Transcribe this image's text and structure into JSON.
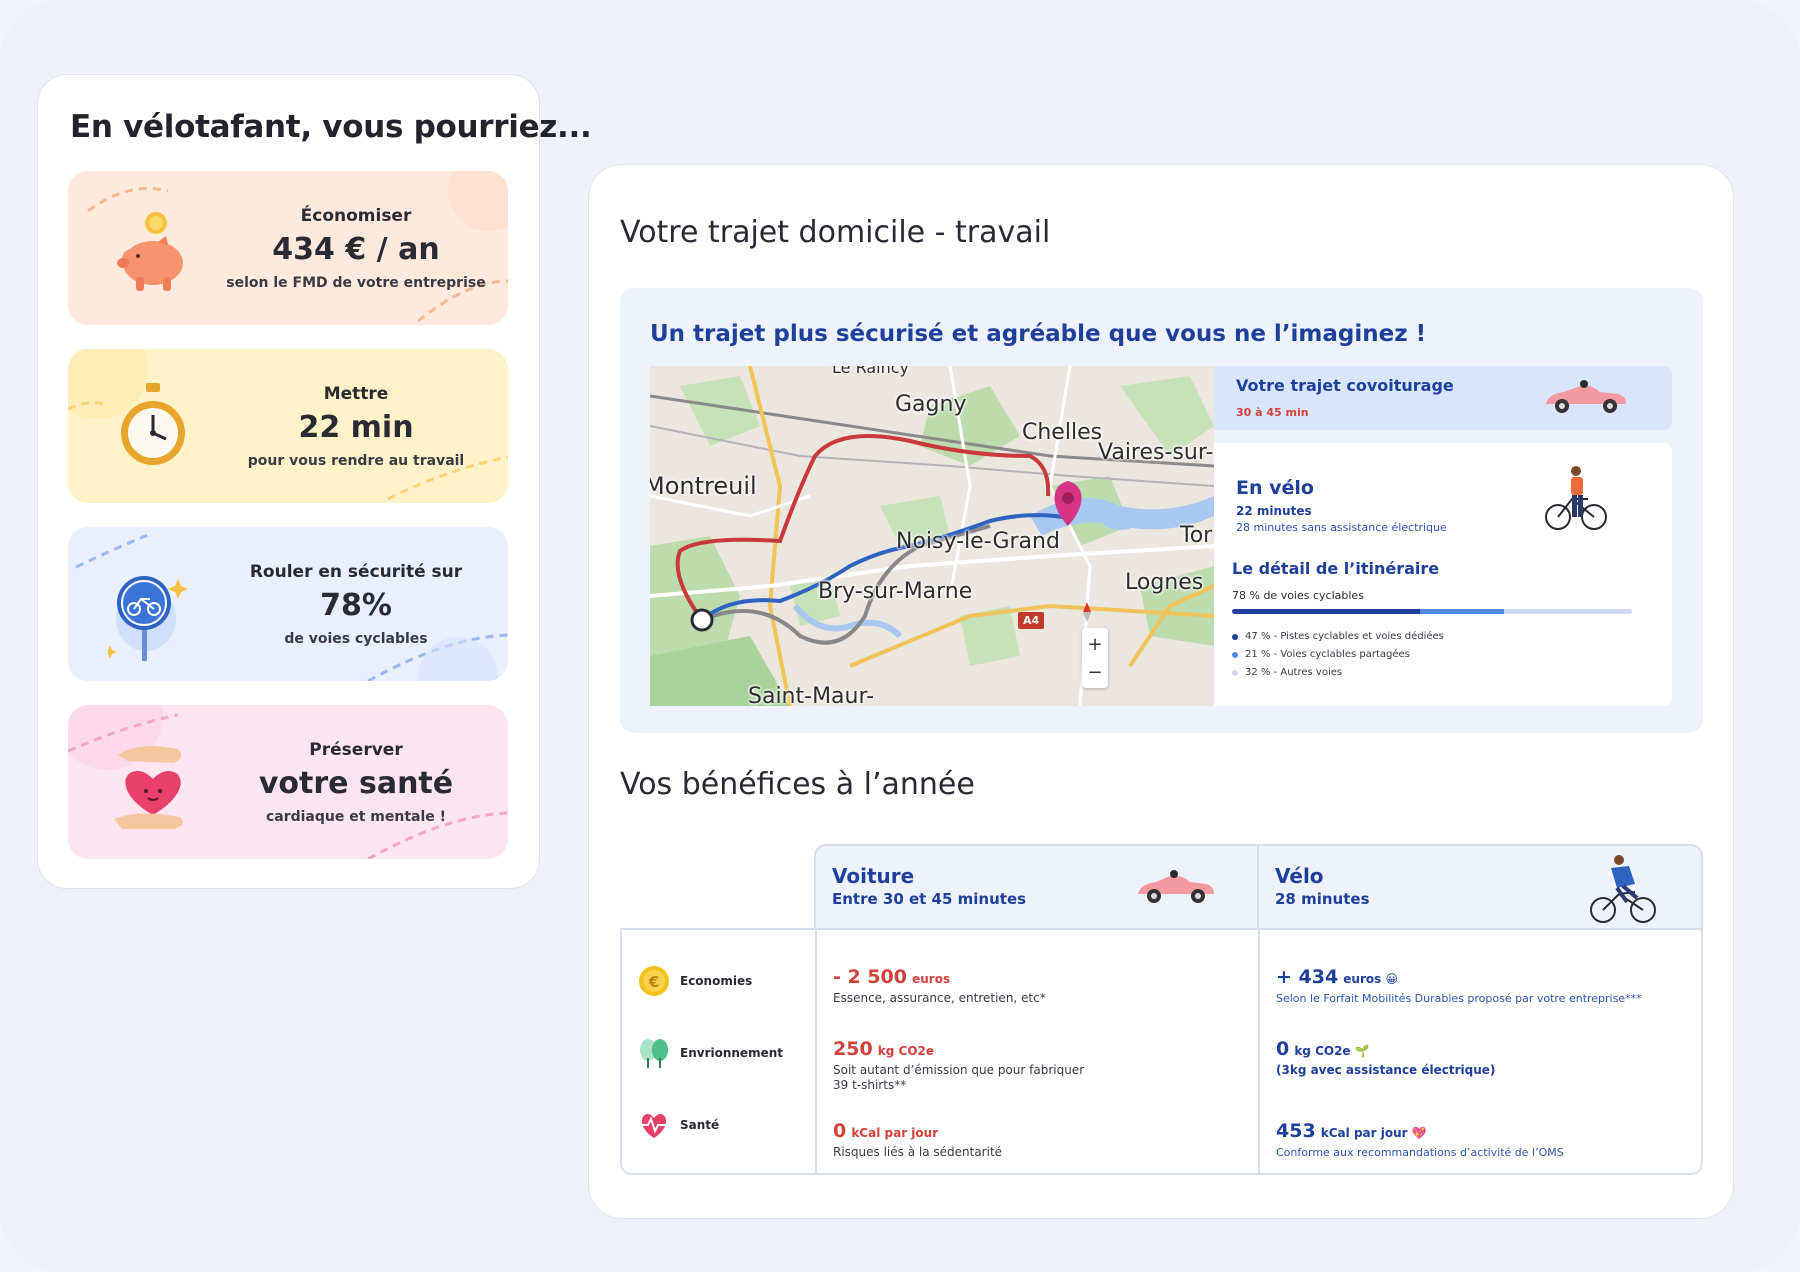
{
  "left": {
    "title": "En vélotafant, vous pourriez...",
    "cards": [
      {
        "l1": "Économiser",
        "l2": "434 € / an",
        "l3": "selon le FMD de votre entreprise",
        "icon": "piggy-bank-icon"
      },
      {
        "l1": "Mettre",
        "l2": "22 min",
        "l3": "pour vous rendre au travail",
        "icon": "stopwatch-icon"
      },
      {
        "l1": "Rouler en sécurité sur",
        "l2": "78%",
        "l3": "de voies cyclables",
        "icon": "bike-lane-sign-icon"
      },
      {
        "l1": "Préserver",
        "l2": "votre santé",
        "l3": "cardiaque et mentale !",
        "icon": "heart-in-hands-icon"
      }
    ]
  },
  "right": {
    "title": "Votre trajet domicile - travail",
    "trip_subtitle": "Un trajet plus sécurisé et agréable que vous ne l’imaginez !",
    "map": {
      "labels": [
        "Le Raincy",
        "Gagny",
        "Chelles",
        "Vaires-sur-Ma",
        "Montreuil",
        "Noisy-le-Grand",
        "Tor",
        "Bry-sur-Marne",
        "Lognes",
        "Saint-Maur-"
      ],
      "road_badge": "A4",
      "zoom_in": "+",
      "zoom_out": "−"
    },
    "covoiturage": {
      "title": "Votre trajet covoiturage",
      "duration": "30 à 45 min"
    },
    "velo": {
      "title": "En vélo",
      "duration": "22 minutes",
      "no_assist": "28 minutes sans assistance électrique",
      "detail_title": "Le détail de l’itinéraire",
      "cycle_pct_label": "78 % de voies cyclables",
      "breakdown": [
        {
          "label": "47 % - Pistes cyclables et voies dédiées",
          "value": 47,
          "color": "#1e3f9a"
        },
        {
          "label": "21 % - Voies cyclables partagées",
          "value": 21,
          "color": "#4f86e8"
        },
        {
          "label": "32 % - Autres voies",
          "value": 32,
          "color": "#cfd9ee"
        }
      ]
    },
    "benefits_title": "Vos bénéfices à l’année",
    "table": {
      "car": {
        "title": "Voiture",
        "subtitle": "Entre 30 et 45 minutes"
      },
      "bike": {
        "title": "Vélo",
        "subtitle": "28 minutes"
      },
      "rows": [
        {
          "label": "Economies",
          "icon": "euro-coin-icon",
          "car_value": "- 2 500",
          "car_unit": "euros",
          "car_note": "Essence, assurance, entretien, etc*",
          "bike_value": "+ 434",
          "bike_unit": "euros 😀",
          "bike_note": "Selon le Forfait Mobilités Durables proposé par votre entreprise***"
        },
        {
          "label": "Envrionnement",
          "icon": "trees-icon",
          "car_value": "250",
          "car_unit": "kg CO2e",
          "car_note": "Soit autant d’émission que pour fabriquer 39 t-shirts**",
          "bike_value": "0",
          "bike_unit": "kg CO2e 🌱",
          "bike_note": "(3kg avec assistance électrique)"
        },
        {
          "label": "Santé",
          "icon": "heartbeat-icon",
          "car_value": "0",
          "car_unit": "kCal par jour",
          "car_note": "Risques liés à la sédentarité",
          "bike_value": "453",
          "bike_unit": "kCal par jour 💖",
          "bike_note": "Conforme aux recommandations d’activité de l’OMS"
        }
      ]
    }
  },
  "colors": {
    "brand_blue": "#1e3f9a",
    "red": "#d3413b",
    "route_red": "#c9383a",
    "route_blue": "#2f63c2"
  }
}
